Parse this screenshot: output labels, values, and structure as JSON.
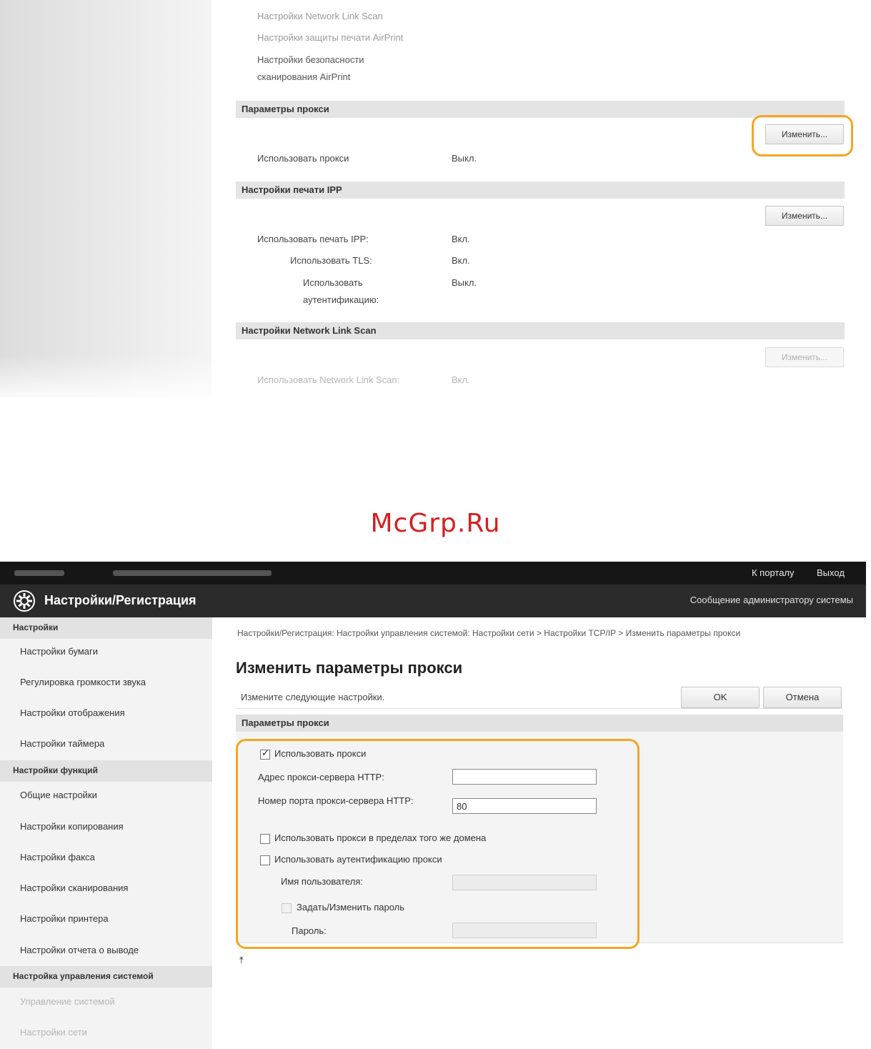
{
  "top_screenshot": {
    "links": [
      {
        "label": "Настройки Network Link Scan"
      },
      {
        "label": "Настройки защиты печати AirPrint"
      },
      {
        "label": "Настройки безопасности"
      },
      {
        "label": "сканирования AirPrint"
      }
    ],
    "sections": [
      {
        "title": "Параметры прокси",
        "button_label": "Изменить...",
        "rows": [
          {
            "label": "Использовать прокси",
            "value": "Выкл."
          }
        ]
      },
      {
        "title": "Настройки печати IPP",
        "button_label": "Изменить...",
        "rows": [
          {
            "label": "Использовать печать IPP:",
            "value": "Вкл."
          },
          {
            "label": "Использовать TLS:",
            "value": "Вкл."
          },
          {
            "label": "Использовать",
            "value": "Выкл."
          },
          {
            "label": "аутентификацию:"
          }
        ]
      },
      {
        "title": "Настройки Network Link Scan",
        "button_label": "Изменить...",
        "rows": [
          {
            "label": "Использовать Network Link Scan:",
            "value": "Вкл."
          }
        ]
      }
    ]
  },
  "watermark": "McGrp.Ru",
  "bottom_screenshot": {
    "topbar": {
      "portal_link": "К порталу",
      "logout_link": "Выход"
    },
    "header": {
      "title": "Настройки/Регистрация",
      "admin_message": "Сообщение администратору системы"
    },
    "sidebar": {
      "categories": [
        {
          "title": "Настройки",
          "items": [
            "Настройки бумаги",
            "Регулировка громкости звука",
            "Настройки отображения",
            "Настройки таймера"
          ]
        },
        {
          "title": "Настройки функций",
          "items": [
            "Общие настройки",
            "Настройки копирования",
            "Настройки факса",
            "Настройки сканирования",
            "Настройки принтера",
            "Настройки отчета о выводе"
          ]
        },
        {
          "title": "Настройка управления системой",
          "items": [
            "Управление системой",
            "Настройки сети"
          ]
        }
      ]
    },
    "main": {
      "breadcrumb": "Настройки/Регистрация: Настройки управления системой: Настройки сети > Настройки TCP/IP > Изменить параметры прокси",
      "page_title": "Изменить параметры прокси",
      "instruction": "Измените следующие настройки.",
      "ok_label": "OK",
      "cancel_label": "Отмена",
      "section_title": "Параметры прокси",
      "form": {
        "use_proxy": {
          "label": "Использовать прокси",
          "checked": true
        },
        "http_proxy_address": {
          "label": "Адрес прокси-сервера HTTP:",
          "value": ""
        },
        "http_proxy_port": {
          "label": "Номер порта прокси-сервера HTTP:",
          "value": "80"
        },
        "same_domain": {
          "label": "Использовать прокси в пределах того же домена",
          "checked": false
        },
        "use_auth": {
          "label": "Использовать аутентификацию прокси",
          "checked": false
        },
        "username": {
          "label": "Имя пользователя:",
          "value": ""
        },
        "set_password": {
          "label": "Задать/Изменить пароль",
          "checked": false
        },
        "password": {
          "label": "Пароль:",
          "value": ""
        }
      }
    },
    "colors": {
      "highlight": "#f5a623",
      "header_bg": "#2b2b2b",
      "topbar_bg": "#161616"
    }
  }
}
